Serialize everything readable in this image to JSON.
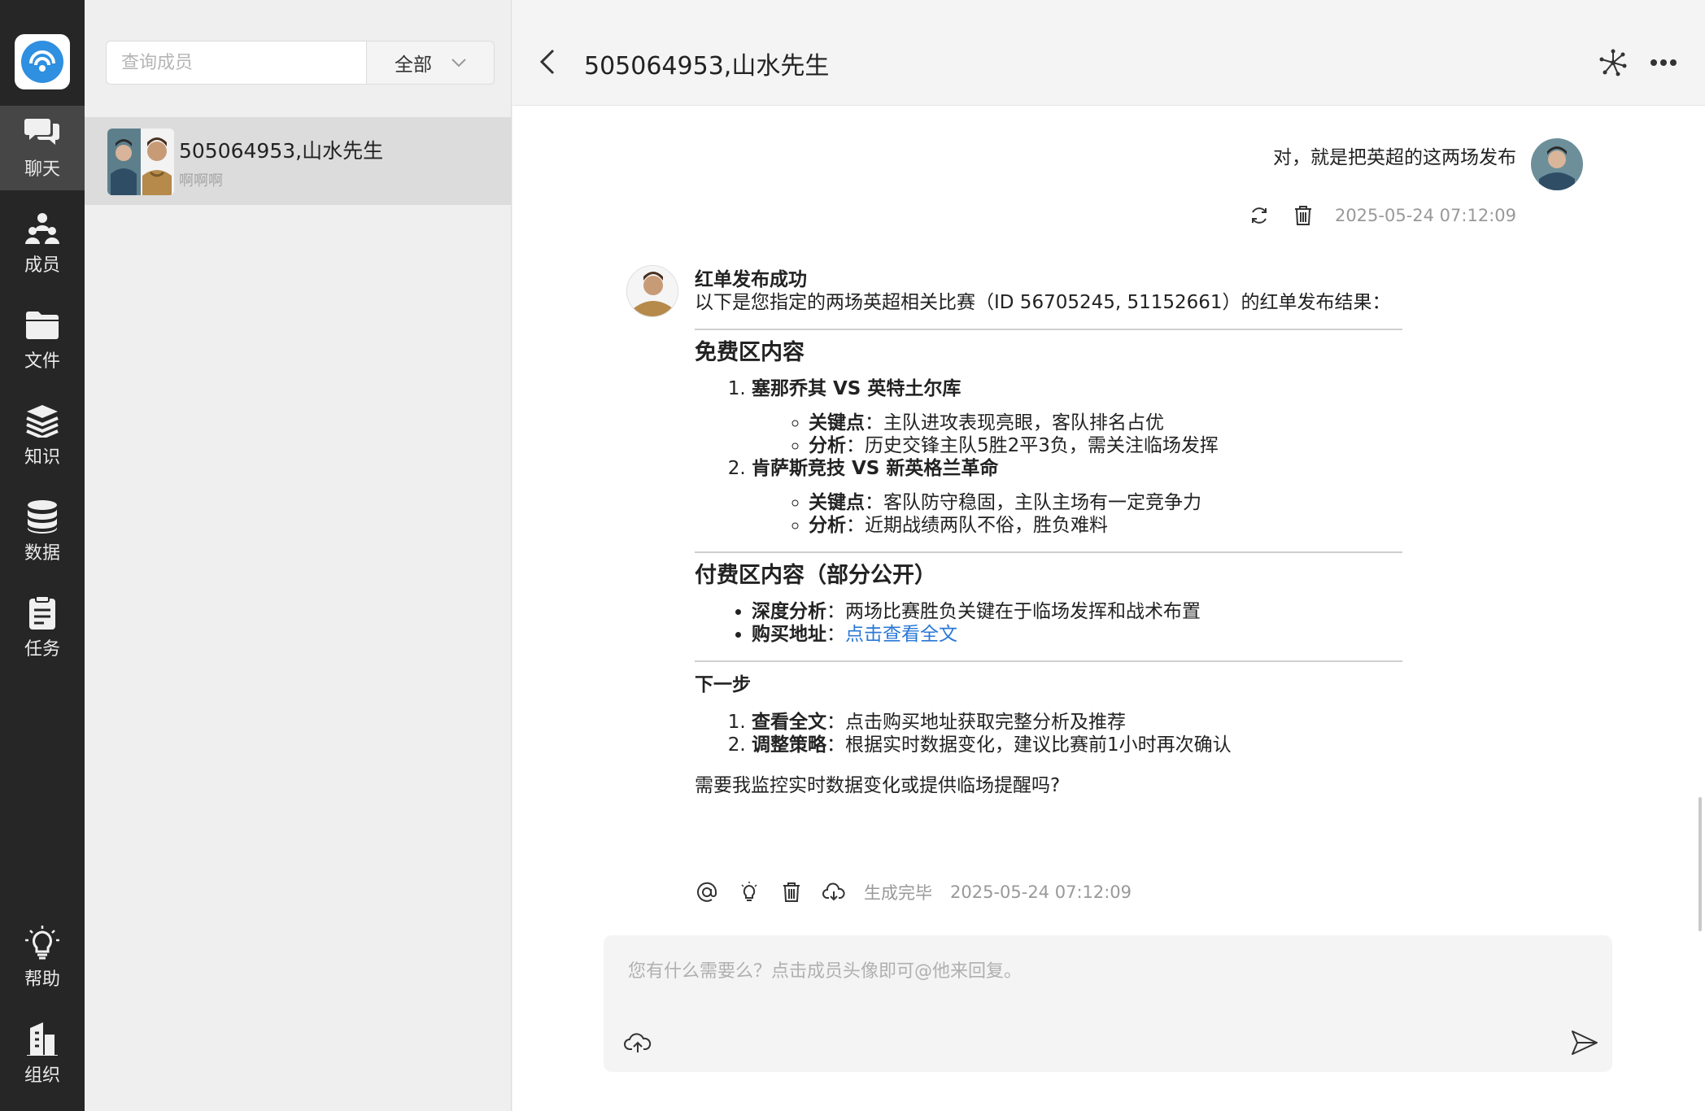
{
  "nav": {
    "items": [
      {
        "label": "聊天",
        "icon": "chat-icon",
        "active": true
      },
      {
        "label": "成员",
        "icon": "members-icon",
        "active": false
      },
      {
        "label": "文件",
        "icon": "folder-icon",
        "active": false
      },
      {
        "label": "知识",
        "icon": "knowledge-icon",
        "active": false
      },
      {
        "label": "数据",
        "icon": "database-icon",
        "active": false
      },
      {
        "label": "任务",
        "icon": "task-icon",
        "active": false
      },
      {
        "label": "帮助",
        "icon": "lightbulb-icon",
        "active": false
      },
      {
        "label": "组织",
        "icon": "building-icon",
        "active": false
      }
    ]
  },
  "contacts": {
    "search_placeholder": "查询成员",
    "filter_value": "全部",
    "items": [
      {
        "name": "505064953,山水先生",
        "preview": "啊啊啊",
        "selected": true
      }
    ]
  },
  "chat": {
    "title": "505064953,山水先生",
    "user_message": {
      "text": "对，就是把英超的这两场发布",
      "timestamp": "2025-05-24 07:12:09"
    },
    "bot_message": {
      "title": "红单发布成功",
      "intro": "以下是您指定的两场英超相关比赛（ID 56705245, 51152661）的红单发布结果：",
      "free_heading": "免费区内容",
      "match1": {
        "name": "塞那乔其 VS 英特土尔库",
        "key_label": "关键点",
        "key_text": "：主队进攻表现亮眼，客队排名占优",
        "analysis_label": "分析",
        "analysis_text": "：历史交锋主队5胜2平3负，需关注临场发挥"
      },
      "match2": {
        "name": "肯萨斯竞技 VS 新英格兰革命",
        "key_label": "关键点",
        "key_text": "：客队防守稳固，主队主场有一定竞争力",
        "analysis_label": "分析",
        "analysis_text": "：近期战绩两队不俗，胜负难料"
      },
      "paid_heading": "付费区内容（部分公开）",
      "paid_items": {
        "deep_label": "深度分析",
        "deep_text": "：两场比赛胜负关键在于临场发挥和战术布置",
        "buy_label": "购买地址",
        "buy_sep": "：",
        "buy_link": "点击查看全文"
      },
      "next_heading": "下一步",
      "next_steps": {
        "step1_label": "查看全文",
        "step1_text": "：点击购买地址获取完整分析及推荐",
        "step2_label": "调整策略",
        "step2_text": "：根据实时数据变化，建议比赛前1小时再次确认"
      },
      "question": "需要我监控实时数据变化或提供临场提醒吗?",
      "status": "生成完毕",
      "timestamp": "2025-05-24 07:12:09"
    }
  },
  "composer": {
    "placeholder": "您有什么需要么？点击成员头像即可@他来回复。"
  },
  "colors": {
    "nav_bg": "#262626",
    "nav_active": "#464646",
    "link": "#2a78d6",
    "logo_blue": "#2f8fe0"
  }
}
